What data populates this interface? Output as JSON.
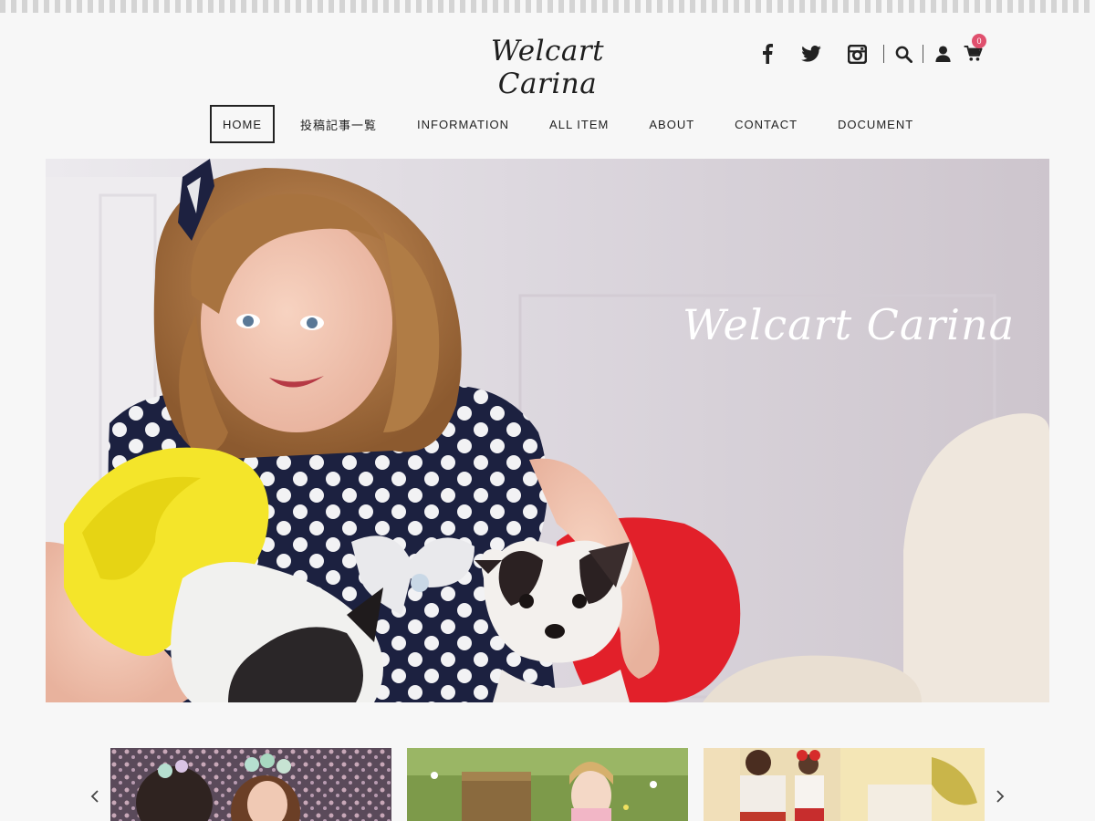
{
  "header": {
    "logo": "Welcart Carina",
    "cart_count": "0",
    "icons": [
      "facebook-icon",
      "twitter-icon",
      "instagram-icon",
      "search-icon",
      "user-icon",
      "cart-icon"
    ]
  },
  "nav": {
    "items": [
      {
        "label": "HOME",
        "active": true
      },
      {
        "label": "投稿記事一覧"
      },
      {
        "label": "INFORMATION"
      },
      {
        "label": "ALL ITEM"
      },
      {
        "label": "ABOUT"
      },
      {
        "label": "CONTACT"
      },
      {
        "label": "DOCUMENT"
      }
    ]
  },
  "hero": {
    "title": "Welcart Carina"
  },
  "carousel": {
    "prev_icon": "chevron-left-icon",
    "next_icon": "chevron-right-icon"
  },
  "colors": {
    "background": "#f7f7f7",
    "text": "#222222",
    "badge": "#e0506e"
  }
}
